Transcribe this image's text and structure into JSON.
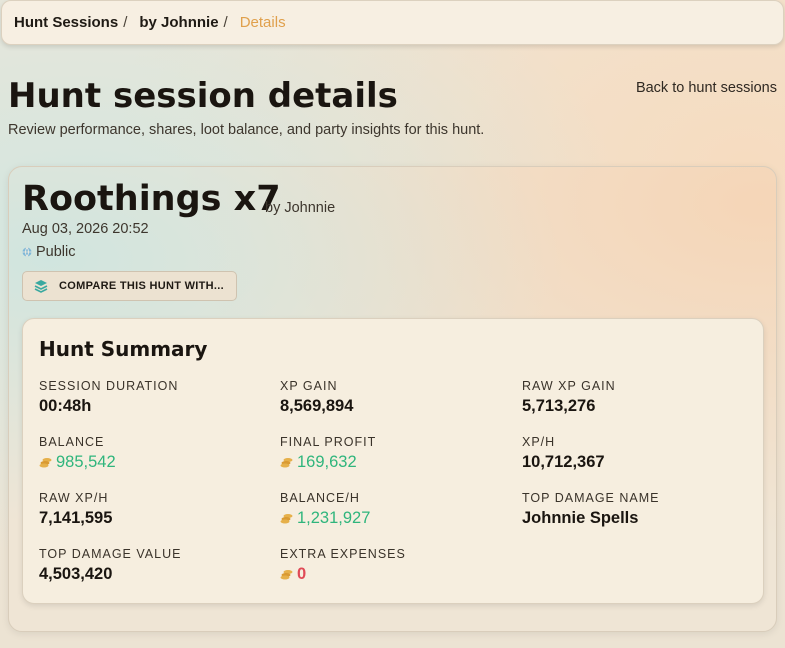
{
  "breadcrumb": {
    "items": [
      "Hunt Sessions",
      "by Johnnie"
    ],
    "separator": "/",
    "current": "Details"
  },
  "page": {
    "title": "Hunt session details",
    "subtitle": "Review performance, shares, loot balance, and party insights for this hunt.",
    "back_link": "Back to hunt sessions"
  },
  "hunt": {
    "name": "Roothings x7",
    "author": "by Johnnie",
    "date": "Aug 03, 2026 20:52",
    "visibility": "Public",
    "compare_button": "COMPARE THIS HUNT WITH..."
  },
  "summary": {
    "title": "Hunt Summary",
    "stats": [
      {
        "label": "SESSION DURATION",
        "value": "00:48h"
      },
      {
        "label": "XP GAIN",
        "value": "8,569,894"
      },
      {
        "label": "RAW XP GAIN",
        "value": "5,713,276"
      },
      {
        "label": "BALANCE",
        "value": "985,542",
        "icon": "coins-icon"
      },
      {
        "label": "FINAL PROFIT",
        "value": "169,632",
        "icon": "coins-icon"
      },
      {
        "label": "XP/H",
        "value": "10,712,367"
      },
      {
        "label": "RAW XP/H",
        "value": "7,141,595"
      },
      {
        "label": "BALANCE/H",
        "value": "1,231,927",
        "icon": "coins-icon"
      },
      {
        "label": "TOP DAMAGE NAME",
        "value": "Johnnie Spells"
      },
      {
        "label": "TOP DAMAGE VALUE",
        "value": "4,503,420"
      },
      {
        "label": "EXTRA EXPENSES",
        "value": "0",
        "icon": "coins-icon"
      }
    ]
  },
  "colors": {
    "accent_orange": "#e0a04c",
    "positive": "#2fb57c",
    "negative": "#e04a56",
    "coin": "#e6b04a",
    "icon_teal": "#3aa9a0"
  }
}
